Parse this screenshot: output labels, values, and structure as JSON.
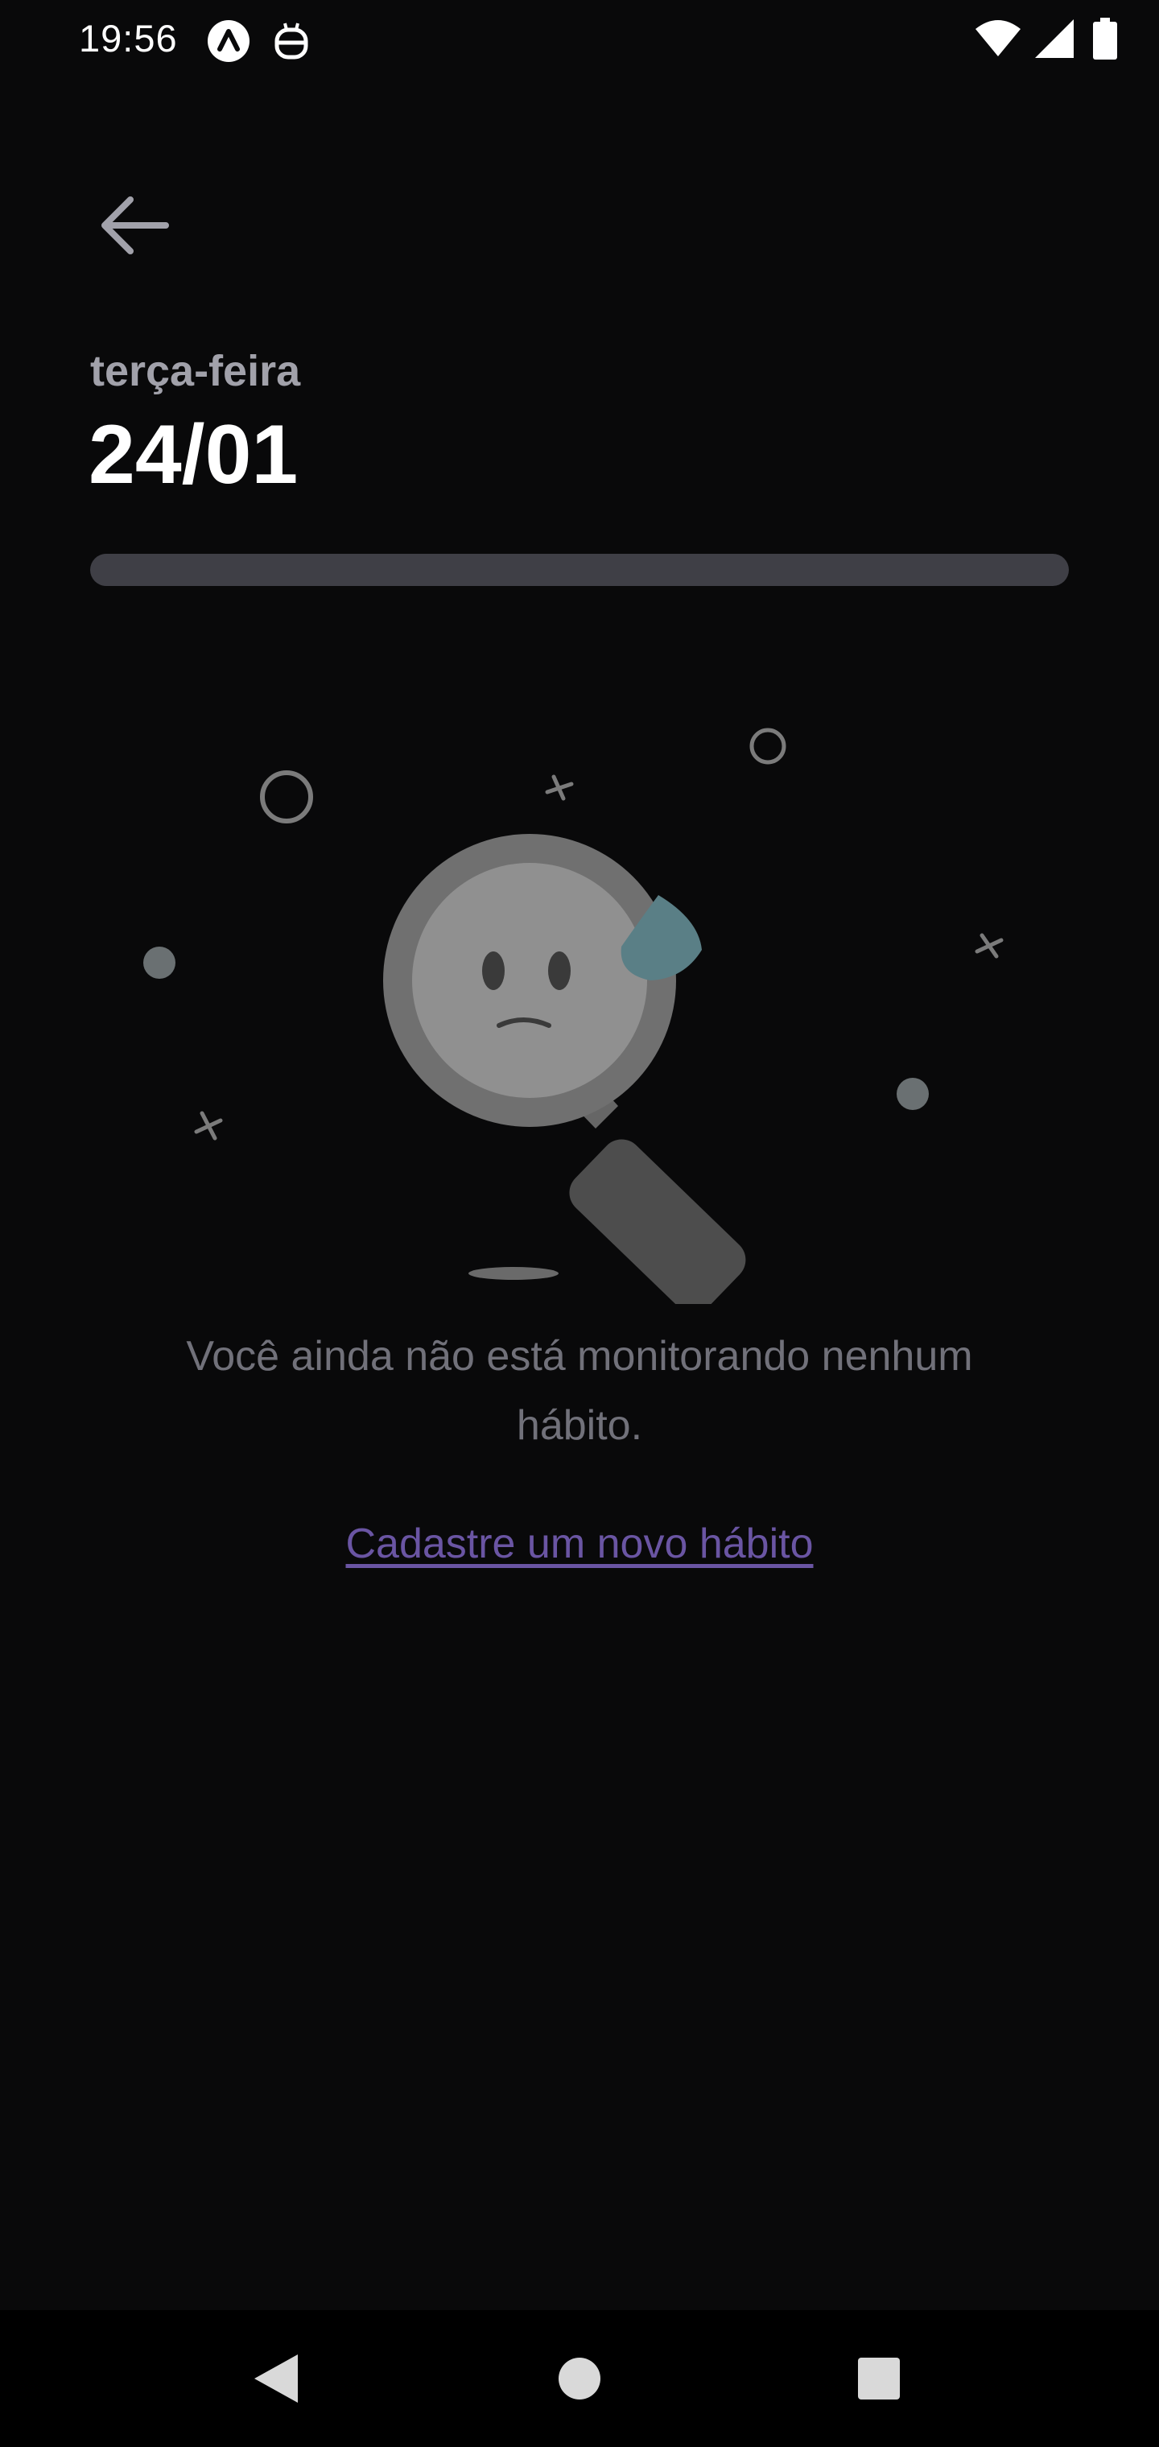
{
  "status_bar": {
    "time": "19:56",
    "icons": [
      "app-a-icon",
      "app-bot-icon",
      "wifi-icon",
      "cellular-signal-icon",
      "battery-icon"
    ]
  },
  "header": {
    "back_icon": "arrow-left-icon",
    "weekday": "terça-feira",
    "date": "24/01"
  },
  "progress": {
    "completed_fraction": 0,
    "track_color": "#3f3f46",
    "fill_color": "#7c3aed"
  },
  "empty_state": {
    "illustration": "sad-magnifying-glass-icon",
    "message": "Você ainda não está monitorando nenhum hábito.",
    "link_label": "Cadastre um novo hábito"
  },
  "navigation_bar": {
    "buttons": [
      "back-triangle-icon",
      "home-circle-icon",
      "recents-square-icon"
    ]
  },
  "colors": {
    "background": "#09090a",
    "weekday_text": "#a1a1aa",
    "message_text": "#71717a",
    "link_text": "#6a55a3"
  }
}
